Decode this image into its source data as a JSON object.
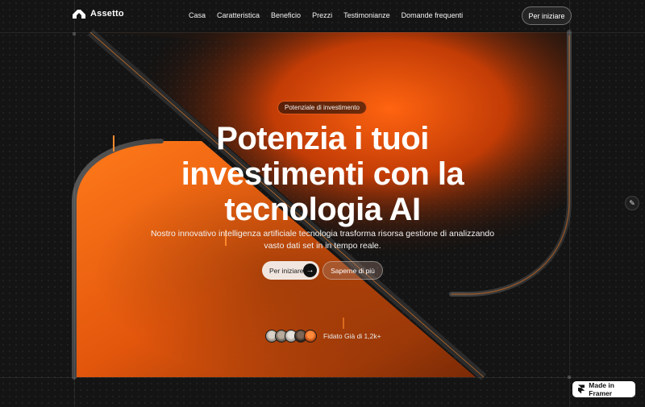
{
  "brand": {
    "name": "Assetto",
    "logo_icon": "arch-logo-icon"
  },
  "nav": {
    "items": [
      {
        "label": "Casa"
      },
      {
        "label": "Caratteristica"
      },
      {
        "label": "Beneficio"
      },
      {
        "label": "Prezzi"
      },
      {
        "label": "Testimonianze"
      },
      {
        "label": "Domande frequenti"
      }
    ],
    "cta_label": "Per iniziare"
  },
  "hero": {
    "badge": "Potenziale di investimento",
    "title": "Potenzia i tuoi investimenti con la tecnologia AI",
    "subtitle": "Nostro innovativo intelligenza artificiale tecnologia trasforma risorsa gestione di analizzando vasto dati set in in tempo reale.",
    "primary_cta": "Per iniziare",
    "primary_cta_icon": "arrow-right-icon",
    "secondary_cta": "Saperne di più",
    "trust_text": "Fidato Già di 1,2k+"
  },
  "framer_badge": {
    "label": "Made in Framer",
    "icon": "framer-icon"
  },
  "edit_icon": "pencil-icon",
  "colors": {
    "accent": "#ff5a0a",
    "accent_light": "#ff8a2b",
    "background": "#141414",
    "button_light": "#f1e6df"
  }
}
